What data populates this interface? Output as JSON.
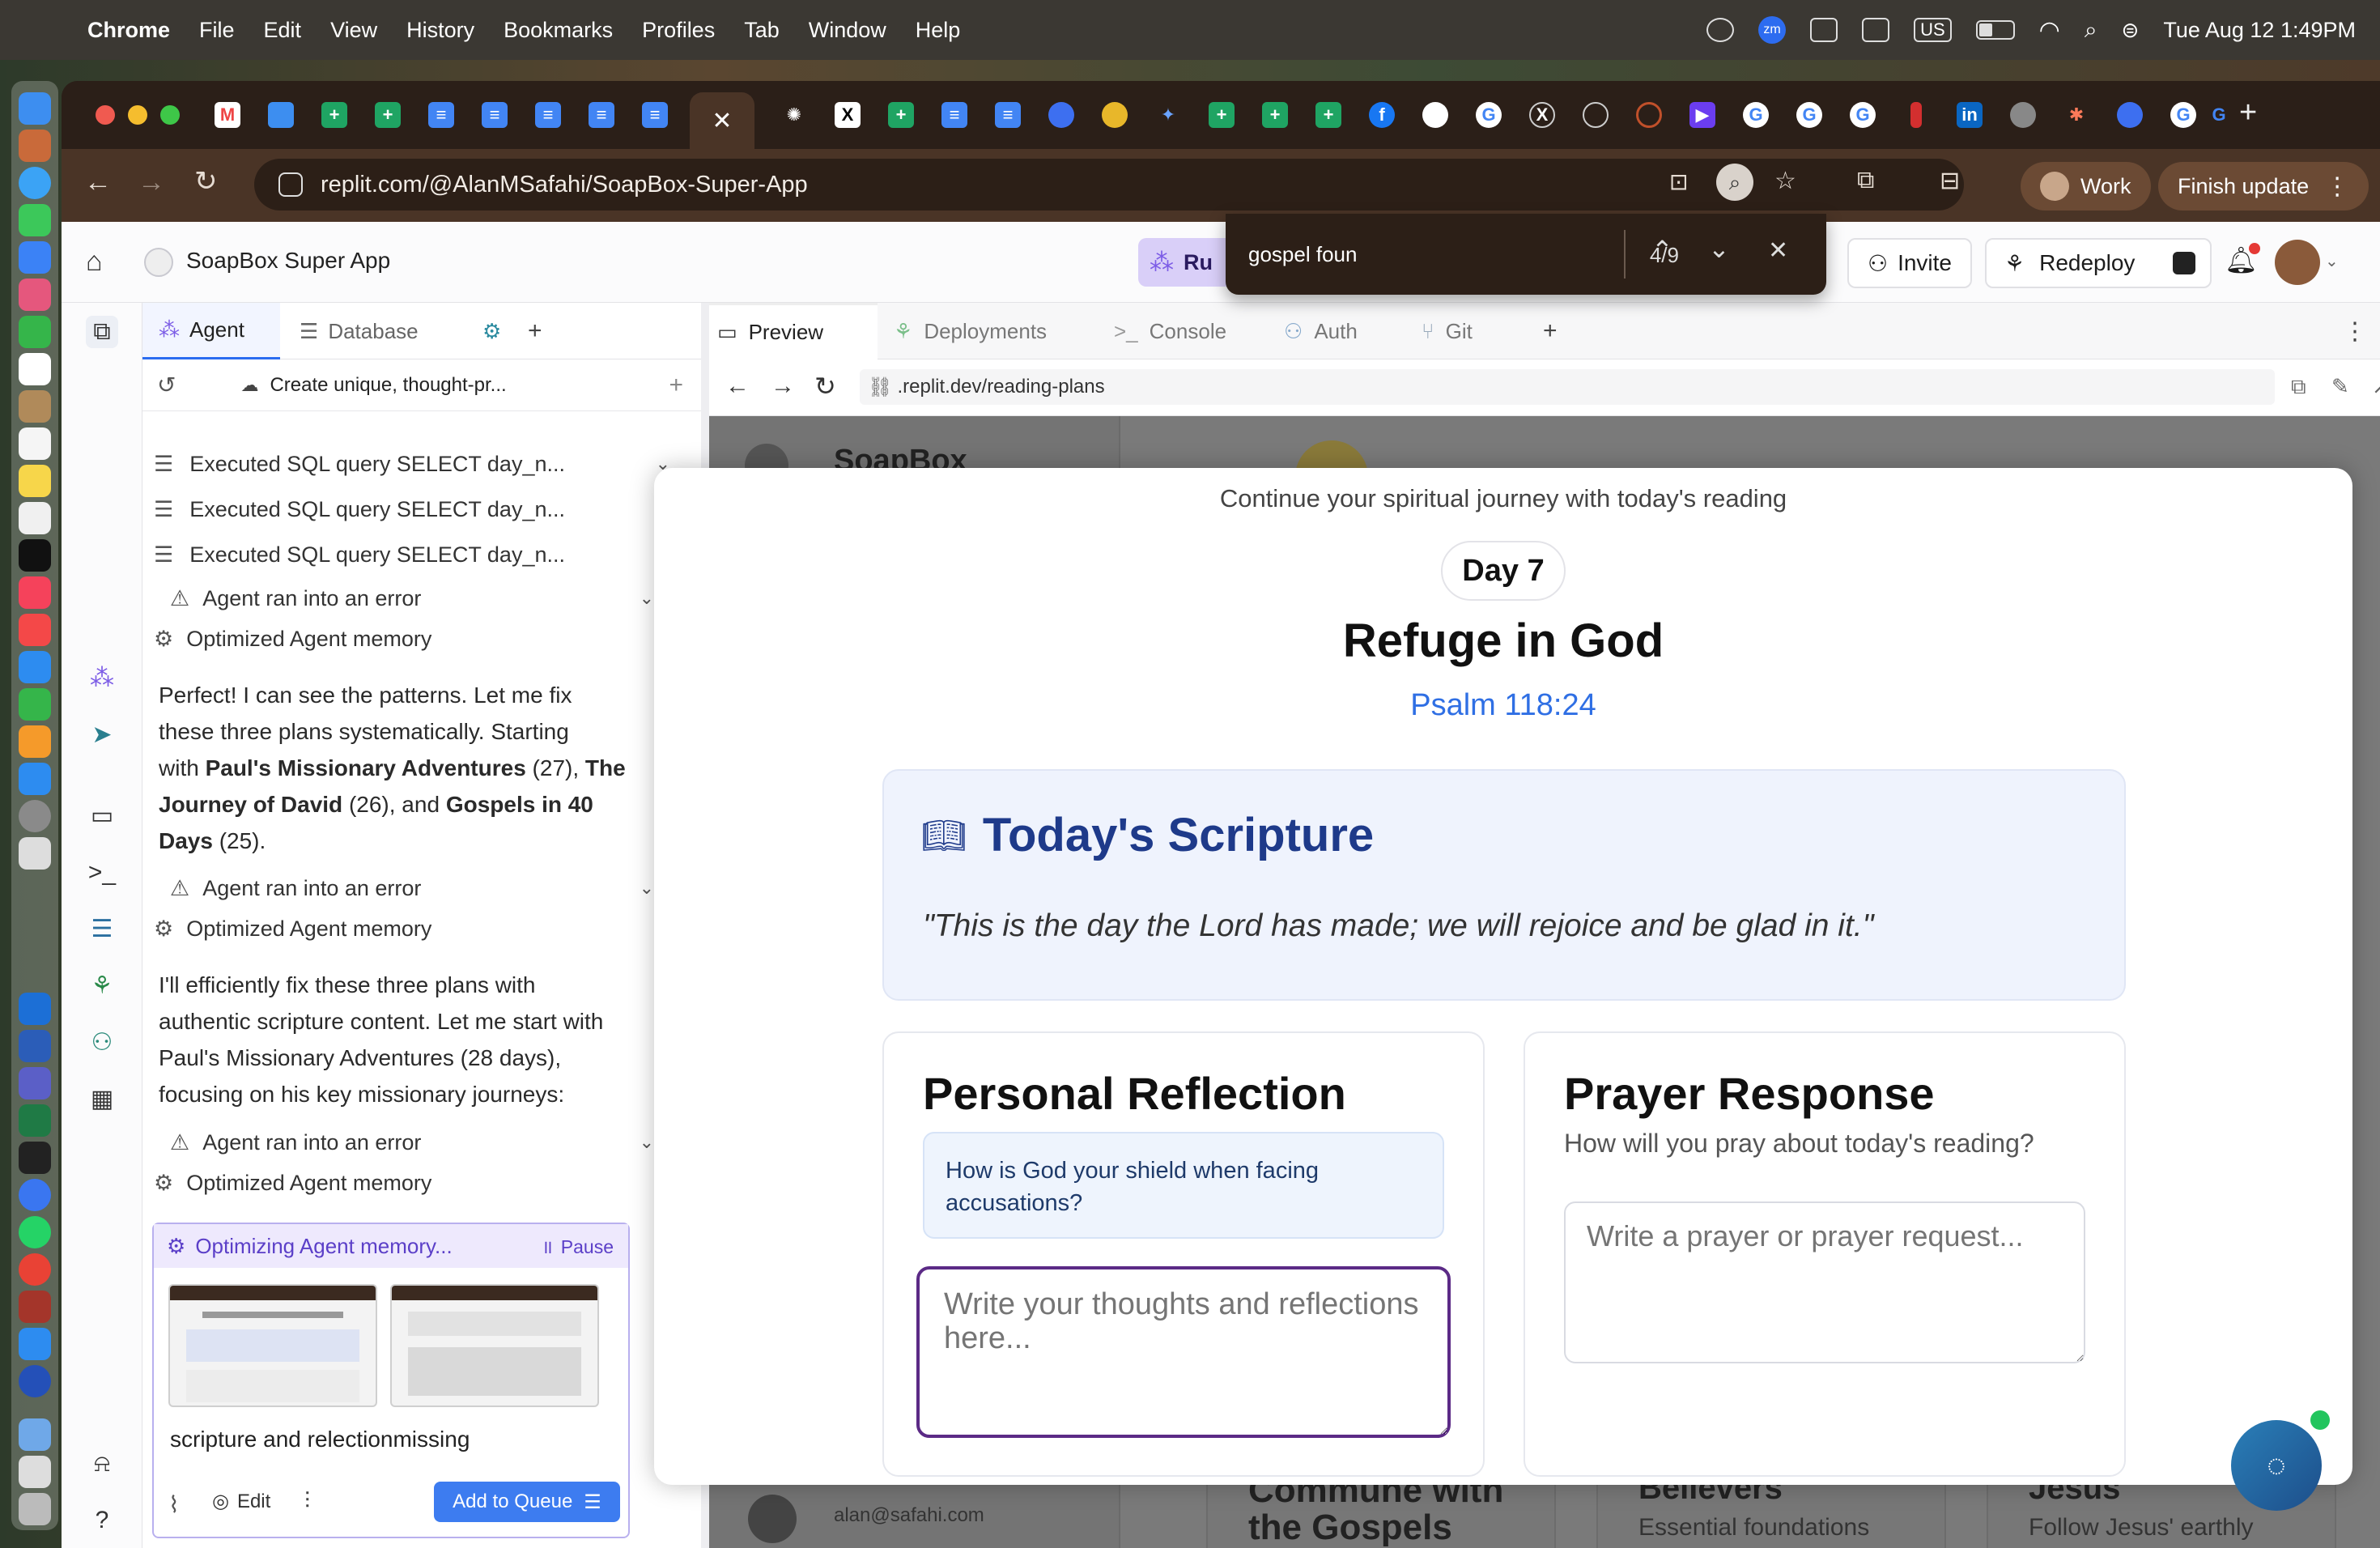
{
  "menubar": {
    "app": "Chrome",
    "menus": [
      "File",
      "Edit",
      "View",
      "History",
      "Bookmarks",
      "Profiles",
      "Tab",
      "Window",
      "Help"
    ],
    "status_keyboard": "US",
    "status_zoom": "zm",
    "clock": "Tue Aug 12  1:49PM"
  },
  "browser": {
    "url": "replit.com/@AlanMSafahi/SoapBox-Super-App",
    "profile_label": "Work",
    "update_label": "Finish update"
  },
  "find": {
    "query": "gospel foun",
    "count": "4/9"
  },
  "app": {
    "project_name": "SoapBox Super App",
    "run_label": "Ru",
    "invite_label": "Invite",
    "redeploy_label": "Redeploy"
  },
  "agent_panel": {
    "tabs": [
      {
        "label": "Agent"
      },
      {
        "label": "Database"
      }
    ],
    "thread_title": "Create unique, thought-pr...",
    "steps": [
      {
        "label": "Executed SQL query SELECT  day_n..."
      },
      {
        "label": "Executed SQL query SELECT  day_n..."
      },
      {
        "label": "Executed SQL query SELECT  day_n..."
      }
    ],
    "error_label": "Agent ran into an error",
    "memory_label": "Optimized Agent memory",
    "msg1_lines": [
      "Perfect! I can see the patterns. Let me fix",
      "these three plans systematically. Starting"
    ],
    "msg1_l3_a": "with ",
    "msg1_l3_b": "Paul's Missionary Adventures",
    "msg1_l3_c": " (27), ",
    "msg1_l3_d": "The",
    "msg1_l4_a": "Journey of David",
    "msg1_l4_b": " (26), and ",
    "msg1_l4_c": "Gospels in 40",
    "msg1_l5_a": "Days",
    "msg1_l5_b": " (25).",
    "msg2_lines": [
      "I'll efficiently fix these three plans with",
      "authentic scripture content. Let me start with",
      "Paul's Missionary Adventures (28 days),",
      "focusing on his key missionary journeys:"
    ],
    "optimizing_label": "Optimizing Agent memory...",
    "pause_label": "Pause",
    "input_text": "scripture and relectionmissing",
    "edit_label": "Edit",
    "queue_label": "Add to Queue"
  },
  "right_tabs": [
    {
      "label": "Preview"
    },
    {
      "label": "Deployments"
    },
    {
      "label": "Console"
    },
    {
      "label": "Auth"
    },
    {
      "label": "Git"
    }
  ],
  "preview_url": ".replit.dev/reading-plans",
  "background_page": {
    "brand": "SoapBox",
    "email": "alan@safahi.com",
    "card1": "the Gospels",
    "card1_top": "Commune with",
    "card2_top": "Believers",
    "card2": "Essential foundations",
    "card3_top": "Jesus",
    "card3": "Follow Jesus' earthly"
  },
  "modal": {
    "subtitle": "Continue your spiritual journey with today's reading",
    "day_badge": "Day 7",
    "title": "Refuge in God",
    "reference": "Psalm 118:24",
    "scripture_heading": "Today's Scripture",
    "scripture_text": "\"This is the day the Lord has made; we will rejoice and be glad in it.\"",
    "reflection_heading": "Personal Reflection",
    "reflection_question": "How is God your shield when facing accusations?",
    "reflection_placeholder": "Write your thoughts and reflections here...",
    "prayer_heading": "Prayer Response",
    "prayer_sub": "How will you pray about today's reading?",
    "prayer_placeholder": "Write a prayer or prayer request..."
  },
  "colors": {
    "accent_blue": "#2f6fe4",
    "scripture_blue": "#1e3a8a",
    "purple_focus": "#5b2a86",
    "agent_purple": "#7c5ce6"
  }
}
